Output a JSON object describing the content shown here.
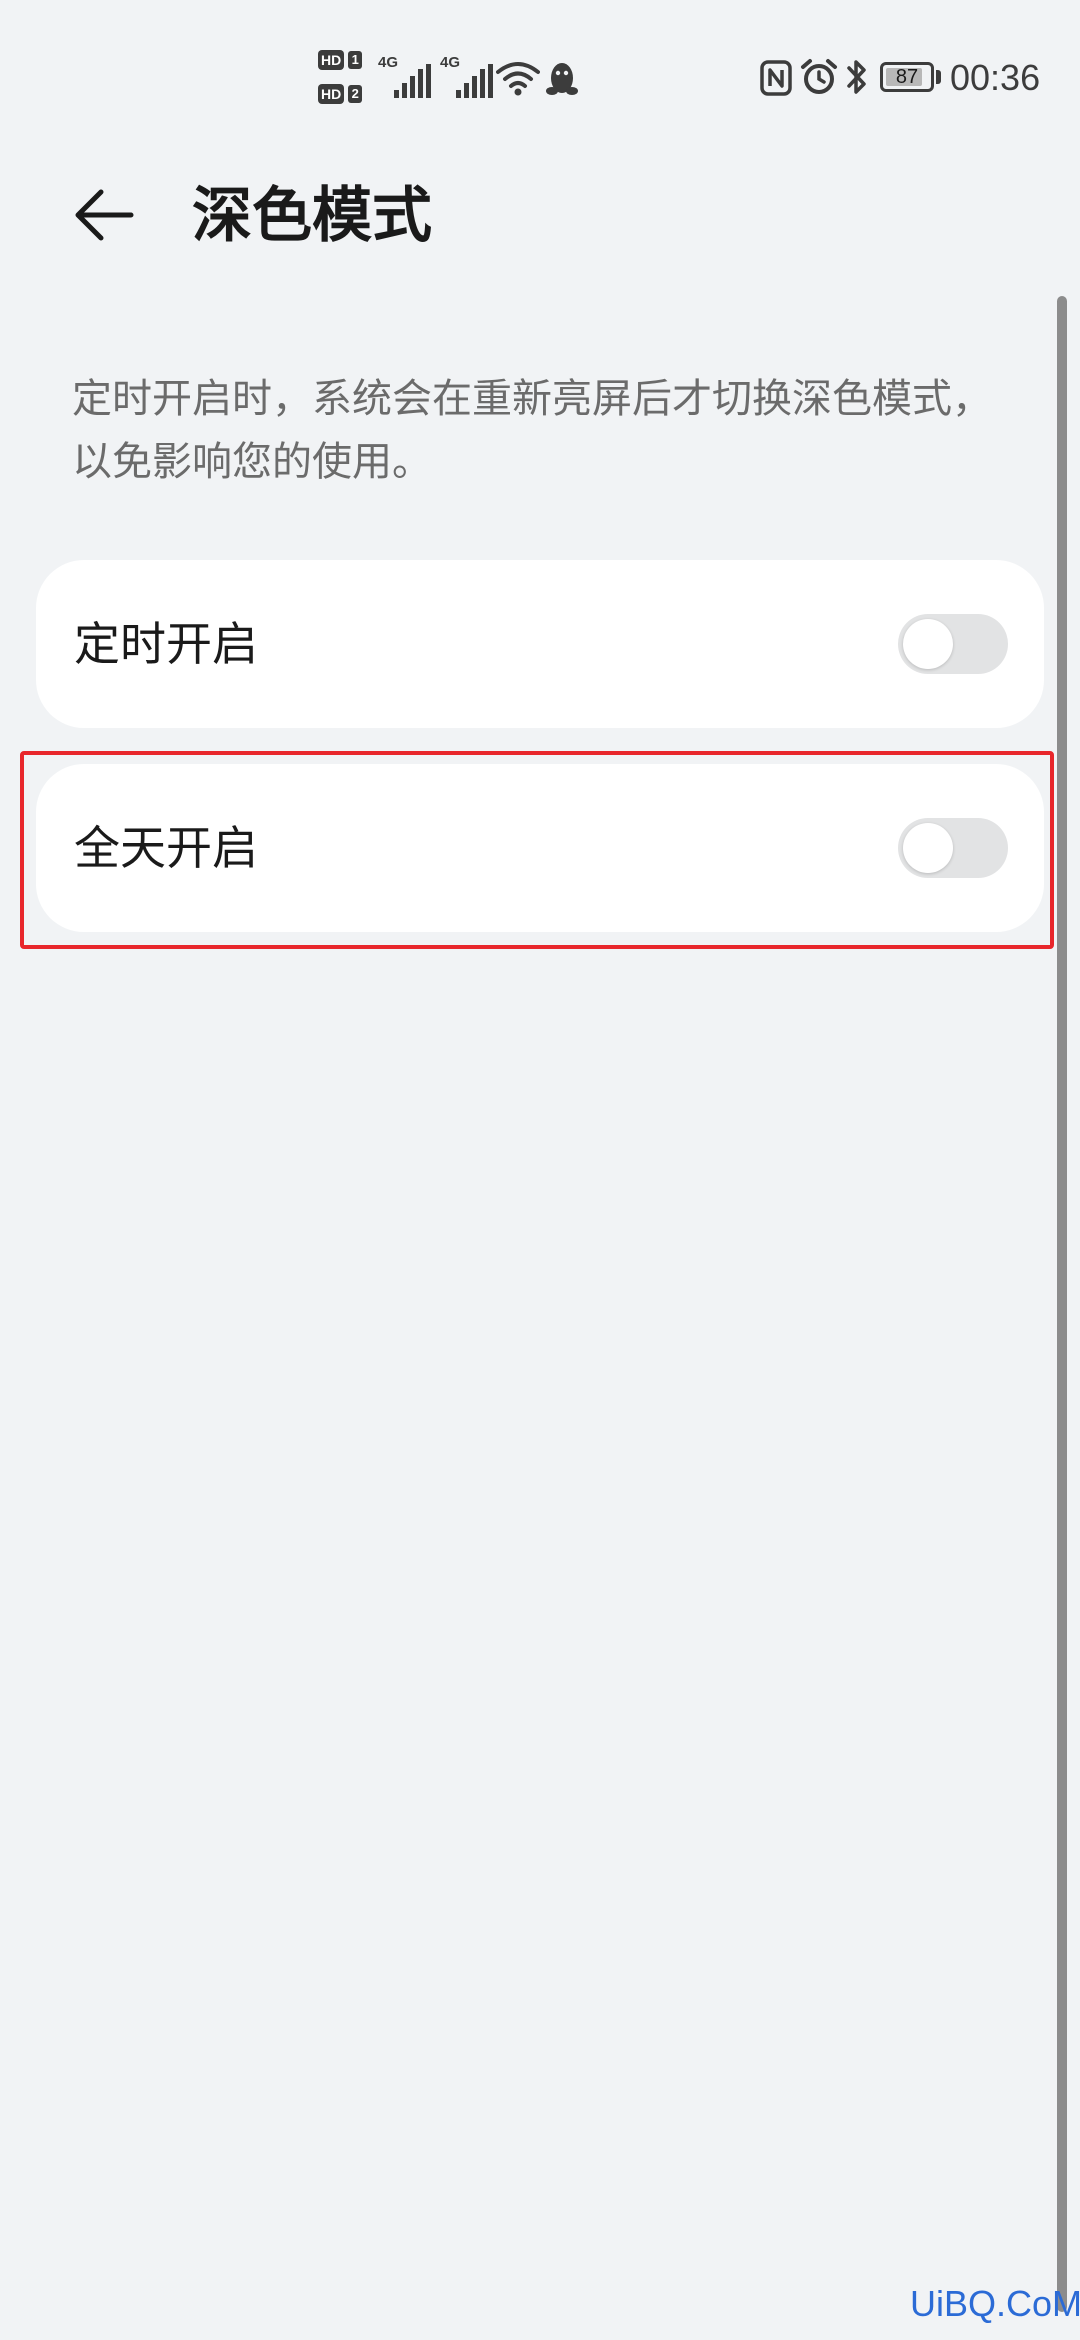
{
  "status_bar": {
    "sim1": {
      "hd": "HD",
      "index": "1",
      "network": "4G"
    },
    "sim2": {
      "hd": "HD",
      "index": "2",
      "network": "4G"
    },
    "battery_level": "87",
    "battery_fraction": 0.87,
    "time": "00:36",
    "icons": [
      "wifi-icon",
      "qq-icon",
      "nfc-icon",
      "alarm-icon",
      "bluetooth-icon",
      "battery-icon"
    ]
  },
  "header": {
    "back_icon": "back-arrow-icon",
    "title": "深色模式"
  },
  "description": "定时开启时，系统会在重新亮屏后才切换深色模式，以免影响您的使用。",
  "settings": [
    {
      "label": "定时开启",
      "enabled": false
    },
    {
      "label": "全天开启",
      "enabled": false,
      "highlighted": true
    }
  ],
  "watermark": "UiBQ.CoM",
  "colors": {
    "background": "#f1f3f5",
    "card": "#ffffff",
    "toggle_off": "#e2e3e4",
    "highlight": "#e8262b",
    "watermark": "#2b6bd6"
  }
}
